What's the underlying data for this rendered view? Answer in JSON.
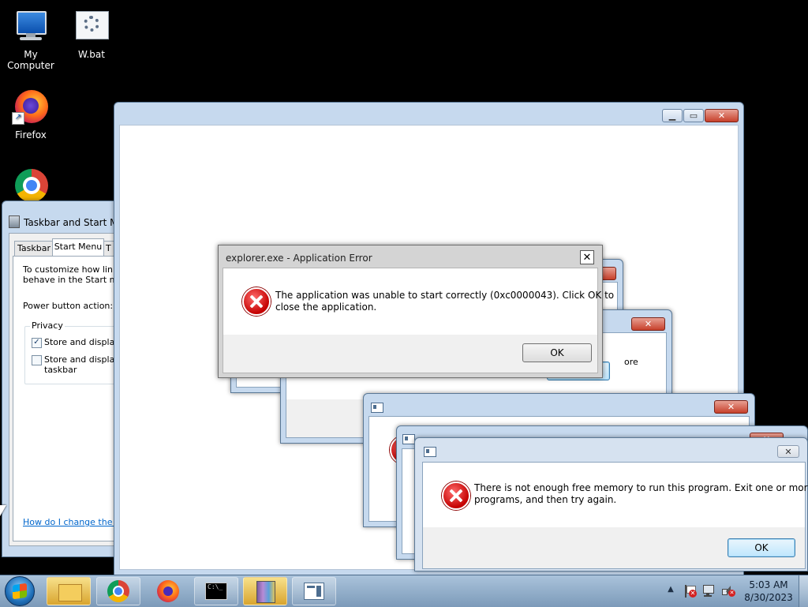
{
  "desktop": {
    "icons": [
      {
        "label": "My Computer",
        "icon": "computer-icon"
      },
      {
        "label": "W.bat",
        "icon": "batch-file-icon"
      },
      {
        "label": "Firefox",
        "icon": "firefox-icon"
      },
      {
        "label": "",
        "icon": "chrome-icon"
      }
    ]
  },
  "taskbar_props": {
    "title": "Taskbar and Start Menu Properties",
    "tabs": [
      "Taskbar",
      "Start Menu",
      "T"
    ],
    "intro_line1": "To customize how links,",
    "intro_line2": "behave in the Start men",
    "power_label": "Power button action:",
    "privacy_group": "Privacy",
    "check1_label": "Store and display r",
    "check2_line1": "Store and display r",
    "check2_line2": "taskbar",
    "help_link": "How do I change the wa"
  },
  "app_error": {
    "title": "explorer.exe - Application Error",
    "message_line1": "The application was unable to start correctly (0xc0000043). Click OK to",
    "message_line2": "close the application.",
    "ok_label": "OK",
    "close_glyph": "✕"
  },
  "behind_text": "ore",
  "memory_error": {
    "message_line1": "There is not enough free memory to run this program. Exit one or more",
    "message_line2": "programs, and then try again.",
    "ok_label": "OK"
  },
  "taskbar": {
    "apps": [
      "start-orb-icon",
      "explorer-icon",
      "chrome-icon",
      "firefox-icon",
      "cmd-icon",
      "archive-icon",
      "window-icon"
    ],
    "time": "5:03 AM",
    "date": "8/30/2023"
  }
}
